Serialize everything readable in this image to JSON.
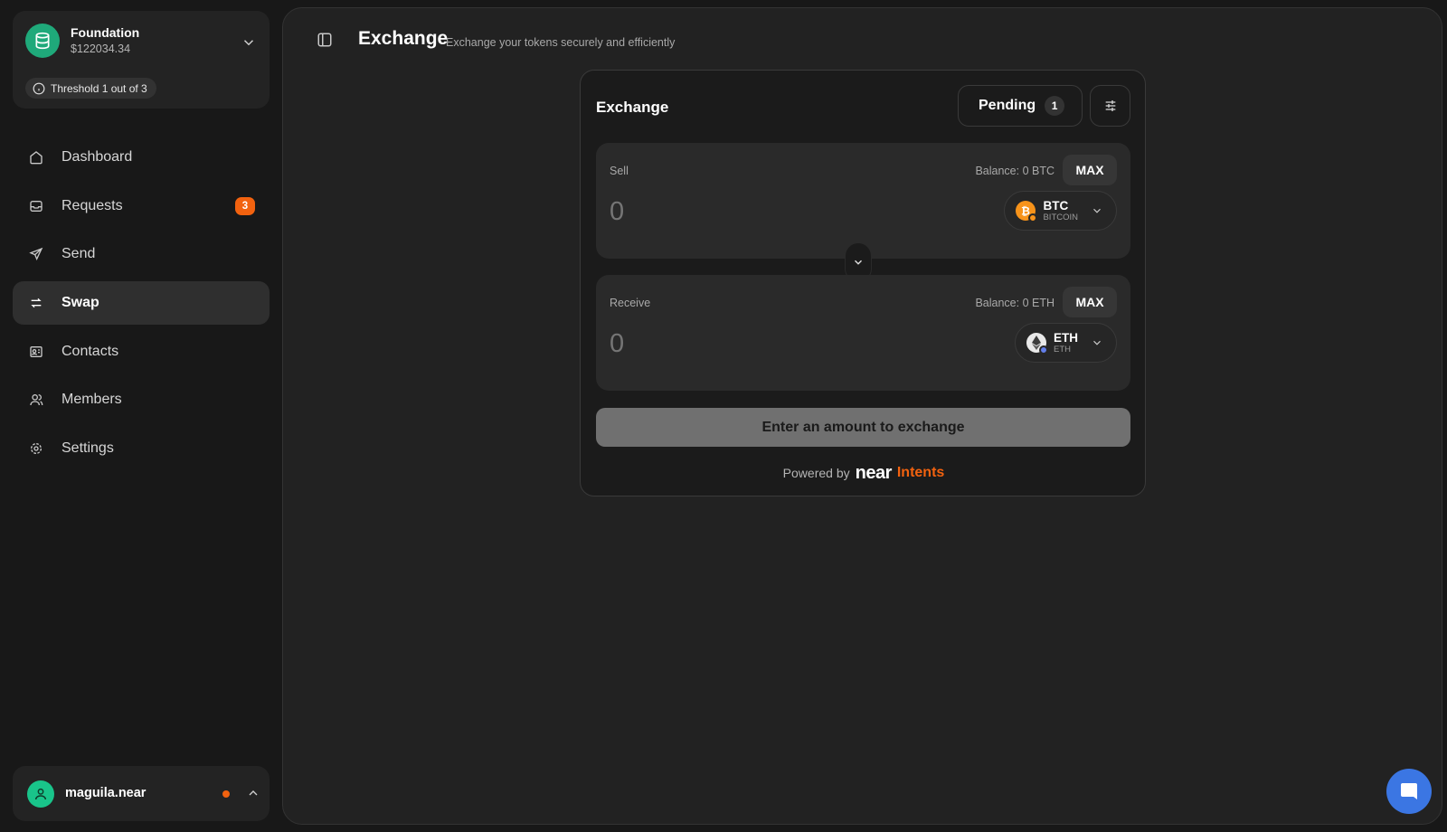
{
  "account": {
    "name": "Foundation",
    "balance": "$122034.34",
    "threshold": "Threshold 1 out of 3",
    "icon": "database-icon"
  },
  "nav": {
    "items": [
      {
        "label": "Dashboard",
        "icon": "home-icon"
      },
      {
        "label": "Requests",
        "icon": "inbox-icon",
        "badge": "3"
      },
      {
        "label": "Send",
        "icon": "send-icon"
      },
      {
        "label": "Swap",
        "icon": "swap-icon",
        "active": true
      },
      {
        "label": "Contacts",
        "icon": "contacts-icon"
      },
      {
        "label": "Members",
        "icon": "members-icon"
      },
      {
        "label": "Settings",
        "icon": "settings-icon"
      }
    ]
  },
  "user": {
    "name": "maguila.near",
    "status_color": "#f2620f"
  },
  "header": {
    "title": "Exchange",
    "subtitle": "Exchange your tokens securely and efficiently"
  },
  "exchange": {
    "title": "Exchange",
    "pending_label": "Pending",
    "pending_count": "1",
    "sell": {
      "label": "Sell",
      "balance": "Balance: 0 BTC",
      "max_label": "MAX",
      "amount": "0",
      "token_symbol": "BTC",
      "token_name": "BITCOIN"
    },
    "receive": {
      "label": "Receive",
      "balance": "Balance: 0 ETH",
      "max_label": "MAX",
      "amount": "0",
      "token_symbol": "ETH",
      "token_name": "ETH"
    },
    "submit_label": "Enter an amount to exchange",
    "powered_by": "Powered by",
    "brand_near": "near",
    "brand_intents": "Intents"
  },
  "colors": {
    "accent": "#f2620f",
    "brand_green": "#1fa97a",
    "chat_blue": "#3b76e3",
    "btc_orange": "#f7931a"
  }
}
